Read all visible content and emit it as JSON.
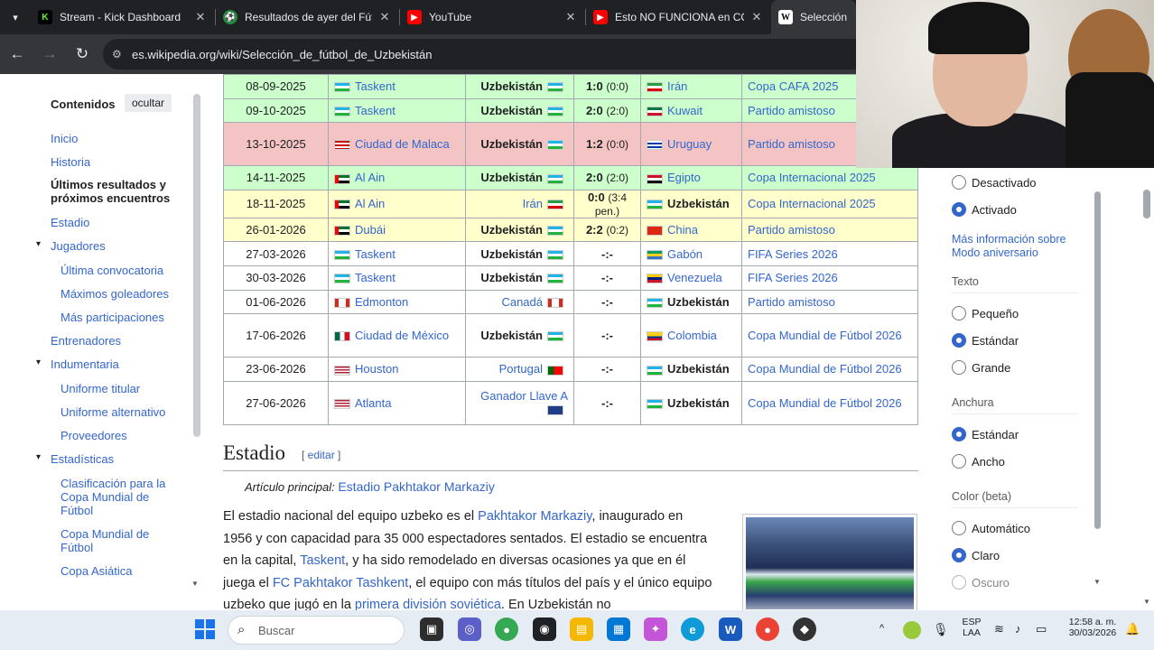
{
  "browser": {
    "tabs": [
      {
        "title": "Stream - Kick Dashboard",
        "icon": "kick-icon",
        "color": "#53fc18"
      },
      {
        "title": "Resultados de ayer del Fútbol",
        "icon": "soccer-ball-icon",
        "color": "#1e8e3e"
      },
      {
        "title": "YouTube",
        "icon": "youtube-icon",
        "color": "#ff0000"
      },
      {
        "title": "Esto NO FUNCIONA en COL",
        "icon": "youtube-icon",
        "color": "#ff0000"
      },
      {
        "title": "Selección d",
        "icon": "wikipedia-icon",
        "color": "#ffffff"
      }
    ],
    "url": "es.wikipedia.org/wiki/Selección_de_fútbol_de_Uzbekistán"
  },
  "toc": {
    "heading": "Contenidos",
    "hide_label": "ocultar",
    "items": [
      {
        "label": "Inicio"
      },
      {
        "label": "Historia"
      },
      {
        "label": "Últimos resultados y próximos encuentros"
      },
      {
        "label": "Estadio"
      },
      {
        "label": "Jugadores"
      },
      {
        "label": "Última convocatoria"
      },
      {
        "label": "Máximos goleadores"
      },
      {
        "label": "Más participaciones"
      },
      {
        "label": "Entrenadores"
      },
      {
        "label": "Indumentaria"
      },
      {
        "label": "Uniforme titular"
      },
      {
        "label": "Uniforme alternativo"
      },
      {
        "label": "Proveedores"
      },
      {
        "label": "Estadísticas"
      },
      {
        "label": "Clasificación para la Copa Mundial de Fútbol"
      },
      {
        "label": "Copa Mundial de Fútbol"
      },
      {
        "label": "Copa Asiática"
      }
    ]
  },
  "matches": [
    {
      "date": "08-09-2025",
      "city": "Taskent",
      "home": "Uzbekistán",
      "score": "1:0",
      "half": "(0:0)",
      "away": "Irán",
      "comp": "Copa CAFA 2025",
      "result": "win"
    },
    {
      "date": "09-10-2025",
      "city": "Taskent",
      "home": "Uzbekistán",
      "score": "2:0",
      "half": "(2:0)",
      "away": "Kuwait",
      "comp": "Partido amistoso",
      "result": "win"
    },
    {
      "date": "13-10-2025",
      "city": "Ciudad de Malaca",
      "home": "Uzbekistán",
      "score": "1:2",
      "half": "(0:0)",
      "away": "Uruguay",
      "comp": "Partido amistoso",
      "result": "loss"
    },
    {
      "date": "14-11-2025",
      "city": "Al Ain",
      "home": "Uzbekistán",
      "score": "2:0",
      "half": "(2:0)",
      "away": "Egipto",
      "comp": "Copa Internacional 2025",
      "result": "win"
    },
    {
      "date": "18-11-2025",
      "city": "Al Ain",
      "home": "Irán",
      "score": "0:0",
      "half": "(3:4 pen.)",
      "away": "Uzbekistán",
      "comp": "Copa Internacional 2025",
      "result": "draw"
    },
    {
      "date": "26-01-2026",
      "city": "Dubái",
      "home": "Uzbekistán",
      "score": "2:2",
      "half": "(0:2)",
      "away": "China",
      "comp": "Partido amistoso",
      "result": "draw"
    },
    {
      "date": "27-03-2026",
      "city": "Taskent",
      "home": "Uzbekistán",
      "score": "-:-",
      "half": "",
      "away": "Gabón",
      "comp": "FIFA Series 2026",
      "result": "none"
    },
    {
      "date": "30-03-2026",
      "city": "Taskent",
      "home": "Uzbekistán",
      "score": "-:-",
      "half": "",
      "away": "Venezuela",
      "comp": "FIFA Series 2026",
      "result": "none"
    },
    {
      "date": "01-06-2026",
      "city": "Edmonton",
      "home": "Canadá",
      "score": "-:-",
      "half": "",
      "away": "Uzbekistán",
      "comp": "Partido amistoso",
      "result": "none"
    },
    {
      "date": "17-06-2026",
      "city": "Ciudad de México",
      "home": "Uzbekistán",
      "score": "-:-",
      "half": "",
      "away": "Colombia",
      "comp": "Copa Mundial de Fútbol 2026",
      "result": "none"
    },
    {
      "date": "23-06-2026",
      "city": "Houston",
      "home": "Portugal",
      "score": "-:-",
      "half": "",
      "away": "Uzbekistán",
      "comp": "Copa Mundial de Fútbol 2026",
      "result": "none"
    },
    {
      "date": "27-06-2026",
      "city": "Atlanta",
      "home": "Ganador Llave A",
      "score": "-:-",
      "half": "",
      "away": "Uzbekistán",
      "comp": "Copa Mundial de Fútbol 2026",
      "result": "none"
    }
  ],
  "section": {
    "title": "Estadio",
    "edit_label": "editar",
    "main_article_prefix": "Artículo principal:",
    "main_article_link": "Estadio Pakhtakor Markaziy",
    "paragraph_parts": [
      {
        "t": "El estadio nacional del equipo uzbeko es el ",
        "link": false
      },
      {
        "t": "Pakhtakor Markaziy",
        "link": true
      },
      {
        "t": ", inaugurado en 1956 y con capacidad para 35 000 espectadores sentados. El estadio se encuentra en la capital, ",
        "link": false
      },
      {
        "t": "Taskent",
        "link": true
      },
      {
        "t": ", y ha sido remodelado en diversas ocasiones ya que en él juega el ",
        "link": false
      },
      {
        "t": "FC Pakhtakor Tashkent",
        "link": true
      },
      {
        "t": ", el equipo con más títulos del país y el único equipo uzbeko que jugó en la ",
        "link": false
      },
      {
        "t": "primera división soviética",
        "link": true
      },
      {
        "t": ". En Uzbekistán no",
        "link": false
      }
    ]
  },
  "settings": {
    "anniversary_off": "Desactivado",
    "anniversary_on": "Activado",
    "more_info": "Más información sobre Modo aniversario",
    "text_heading": "Texto",
    "text_options": [
      "Pequeño",
      "Estándar",
      "Grande"
    ],
    "text_selected": "Estándar",
    "width_heading": "Anchura",
    "width_options": [
      "Estándar",
      "Ancho"
    ],
    "width_selected": "Estándar",
    "color_heading": "Color (beta)",
    "color_options": [
      "Automático",
      "Claro",
      "Oscuro"
    ],
    "color_selected": "Claro"
  },
  "taskbar": {
    "search_placeholder": "Buscar",
    "lang_top": "ESP",
    "lang_bottom": "LAA",
    "time": "12:58 a. m.",
    "date": "30/03/2026"
  },
  "colors": {
    "link": "#3366cc",
    "win_row": "#ccffcc",
    "loss_row": "#f4c4c4",
    "draw_row": "#ffffcc"
  }
}
